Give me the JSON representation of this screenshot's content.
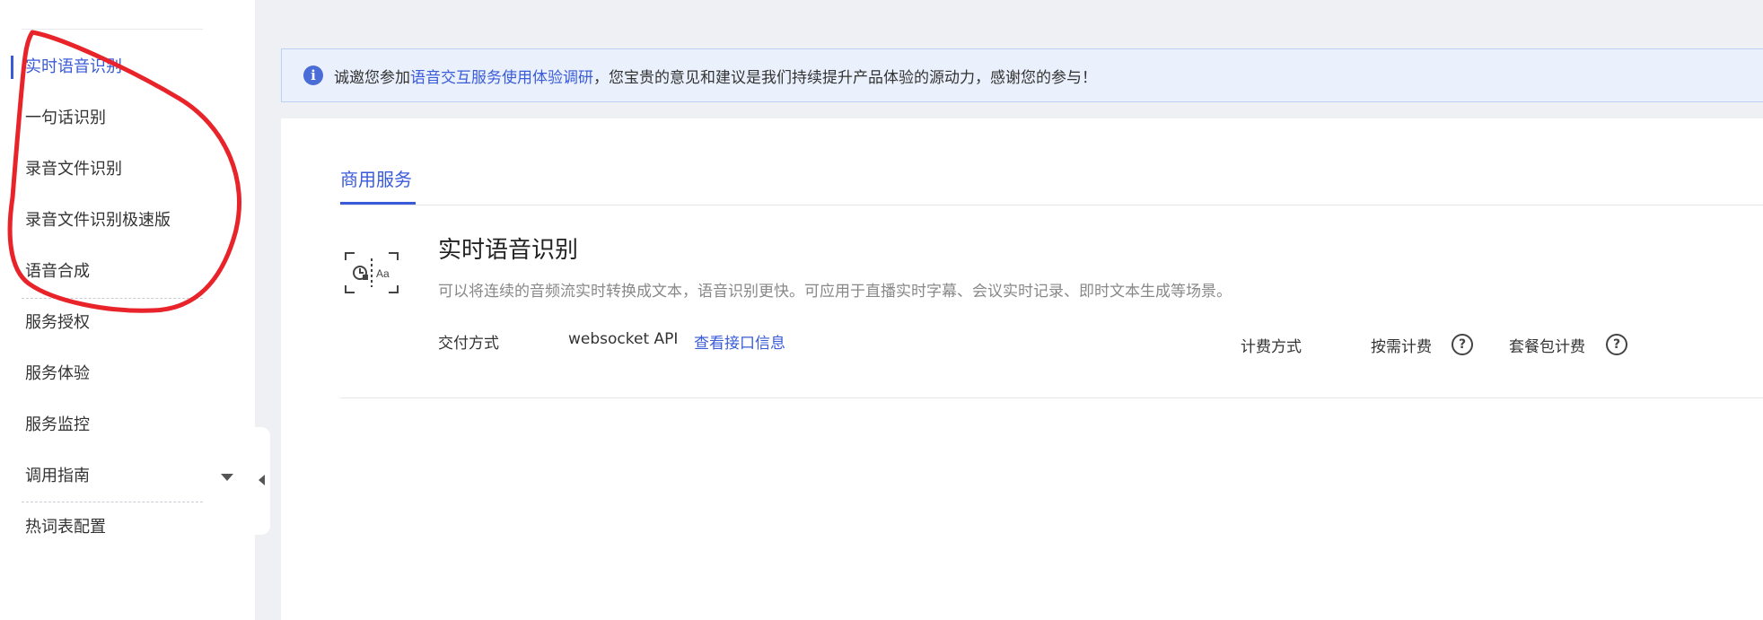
{
  "sidebar": {
    "items": [
      {
        "label": "实时语音识别",
        "active": true
      },
      {
        "label": "一句话识别"
      },
      {
        "label": "录音文件识别"
      },
      {
        "label": "录音文件识别极速版"
      },
      {
        "label": "语音合成"
      },
      {
        "label": "服务授权"
      },
      {
        "label": "服务体验"
      },
      {
        "label": "服务监控"
      },
      {
        "label": "调用指南",
        "icon": "caret-down-icon"
      },
      {
        "label": "热词表配置"
      }
    ]
  },
  "notice": {
    "icon": "info-icon",
    "prefix": "诚邀您参加",
    "link": "语音交互服务使用体验调研",
    "suffix": "，您宝贵的意见和建议是我们持续提升产品体验的源动力，感谢您的参与！"
  },
  "tabs": [
    {
      "label": "商用服务",
      "active": true
    }
  ],
  "service": {
    "icon": "speech-to-text-icon",
    "title": "实时语音识别",
    "description": "可以将连续的音频流实时转换成文本，语音识别更快。可应用于直播实时字幕、会议实时记录、即时文本生成等场景。",
    "delivery_label": "交付方式",
    "delivery_value": "websocket API",
    "delivery_link": "查看接口信息",
    "billing_label": "计费方式",
    "billing_options": [
      {
        "label": "按需计费",
        "help_icon": "question-circle-icon"
      },
      {
        "label": "套餐包计费",
        "help_icon": "question-circle-icon"
      }
    ]
  },
  "colors": {
    "accent": "#3a5bd9",
    "annotation": "#e8232a",
    "notice_bg": "#eaf1fd"
  }
}
